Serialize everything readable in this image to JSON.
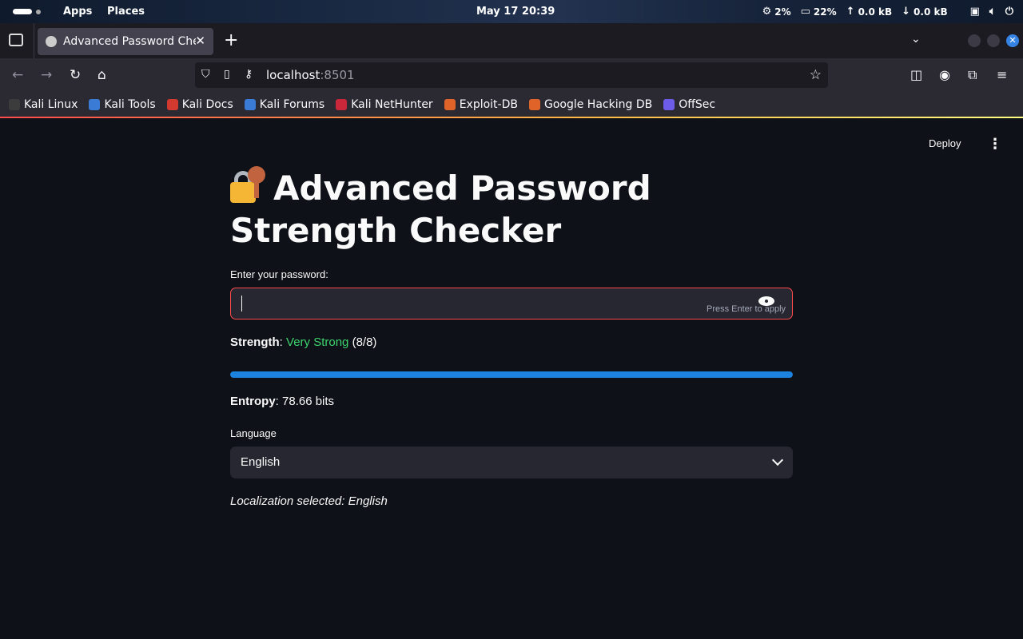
{
  "system_bar": {
    "apps_label": "Apps",
    "places_label": "Places",
    "datetime": "May 17  20:39",
    "cpu": "2%",
    "memory": "22%",
    "upload": "0.0 kB",
    "download": "0.0 kB"
  },
  "browser": {
    "tab_title": "Advanced Password Checker",
    "url_host": "localhost",
    "url_port": ":8501",
    "bookmarks": [
      {
        "label": "Kali Linux",
        "color": "#3c3c3c"
      },
      {
        "label": "Kali Tools",
        "color": "#3a7bd5"
      },
      {
        "label": "Kali Docs",
        "color": "#d33a2f"
      },
      {
        "label": "Kali Forums",
        "color": "#3a7bd5"
      },
      {
        "label": "Kali NetHunter",
        "color": "#c8283a"
      },
      {
        "label": "Exploit-DB",
        "color": "#e0632a"
      },
      {
        "label": "Google Hacking DB",
        "color": "#e0632a"
      },
      {
        "label": "OffSec",
        "color": "#6c5ce7"
      }
    ]
  },
  "app": {
    "deploy_label": "Deploy",
    "title": "Advanced Password Strength Checker",
    "password_label": "Enter your password:",
    "password_value": "",
    "press_enter_hint": "Press Enter to apply",
    "strength_label": "Strength",
    "strength_value": "Very Strong",
    "strength_score": "(8/8)",
    "strength_fraction": 1.0,
    "entropy_label": "Entropy",
    "entropy_value": "78.66 bits",
    "language_label": "Language",
    "language_selected": "English",
    "localization_text": "Localization selected: English"
  },
  "colors": {
    "background": "#0e1117",
    "accent_red": "#ff4b4b",
    "success_green": "#3dd56d",
    "progress_blue": "#1c83e1"
  }
}
